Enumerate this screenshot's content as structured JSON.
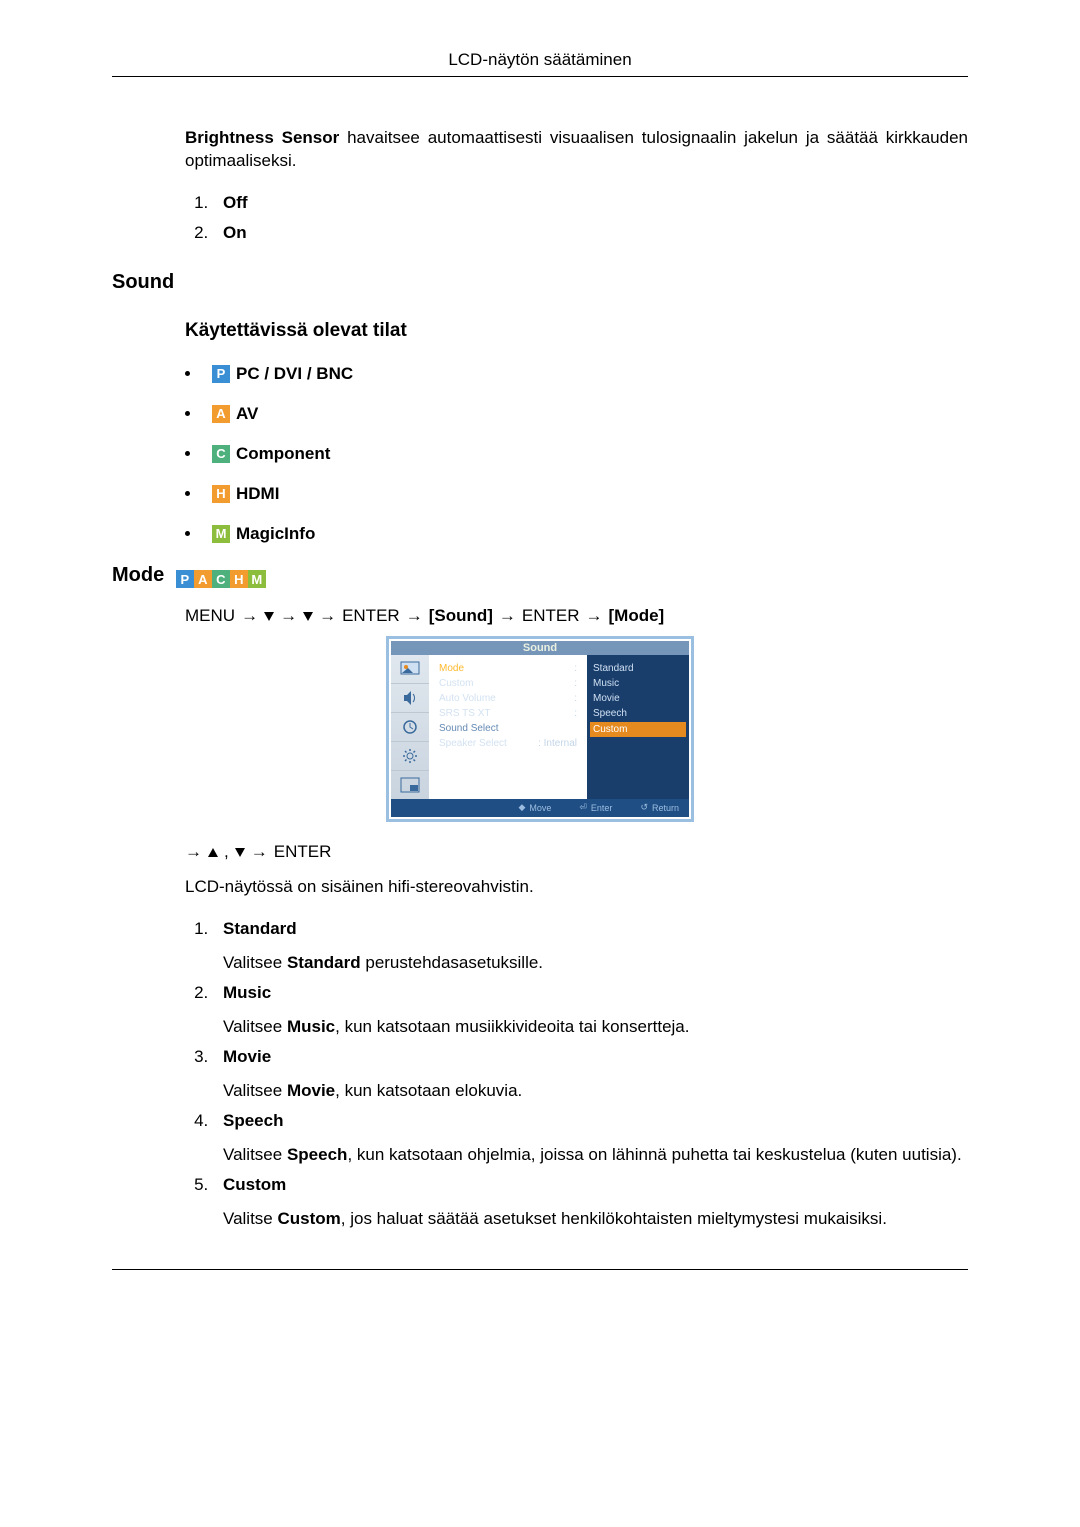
{
  "header": {
    "title": "LCD-näytön säätäminen"
  },
  "brightness": {
    "text_before": "Brightness Sensor",
    "text_after": " havaitsee automaattisesti visuaalisen tulosignaalin jakelun ja säätää kirkkauden optimaaliseksi.",
    "options": [
      "Off",
      "On"
    ]
  },
  "sound": {
    "heading": "Sound",
    "sub_heading": "Käytettävissä olevat tilat",
    "modes": [
      {
        "icon": "P",
        "label": "PC / DVI / BNC"
      },
      {
        "icon": "A",
        "label": "AV"
      },
      {
        "icon": "C",
        "label": "Component"
      },
      {
        "icon": "H",
        "label": "HDMI"
      },
      {
        "icon": "M",
        "label": "MagicInfo"
      }
    ]
  },
  "mode": {
    "heading": "Mode",
    "strip": [
      "P",
      "A",
      "C",
      "H",
      "M"
    ],
    "nav1": {
      "menu": "MENU",
      "enter": "ENTER",
      "sound_label": "[Sound]",
      "mode_label": "[Mode]"
    },
    "nav2": {
      "enter": "ENTER"
    },
    "body_text": "LCD-näytössä on sisäinen hifi-stereovahvistin.",
    "items": [
      {
        "n": "1",
        "label": "Standard",
        "desc_before": "Valitsee ",
        "bold": "Standard",
        "desc_after": " perustehdasasetuksille."
      },
      {
        "n": "2",
        "label": "Music",
        "desc_before": "Valitsee ",
        "bold": "Music",
        "desc_after": ", kun katsotaan musiikkivideoita tai konsertteja."
      },
      {
        "n": "3",
        "label": "Movie",
        "desc_before": "Valitsee ",
        "bold": "Movie",
        "desc_after": ", kun katsotaan elokuvia."
      },
      {
        "n": "4",
        "label": "Speech",
        "desc_before": "Valitsee ",
        "bold": "Speech",
        "desc_after": ", kun katsotaan ohjelmia, joissa on lähinnä puhetta tai keskustelua (kuten uutisia)."
      },
      {
        "n": "5",
        "label": "Custom",
        "desc_before": "Valitse ",
        "bold": "Custom",
        "desc_after": ", jos haluat säätää asetukset henkilökohtaisten mieltymystesi mukaisiksi."
      }
    ]
  },
  "osd": {
    "title": "Sound",
    "left_items": [
      {
        "label": "Mode",
        "selected": true
      },
      {
        "label": "Custom"
      },
      {
        "label": "Auto Volume"
      },
      {
        "label": "SRS TS XT"
      },
      {
        "label": "Sound Select",
        "dim": true
      },
      {
        "label": "Speaker Select"
      }
    ],
    "right_items": [
      "Standard",
      "Music",
      "Movie",
      "Speech",
      "Custom"
    ],
    "speaker_value": ": Internal",
    "footer": {
      "move": "Move",
      "enter": "Enter",
      "return": "Return"
    }
  }
}
